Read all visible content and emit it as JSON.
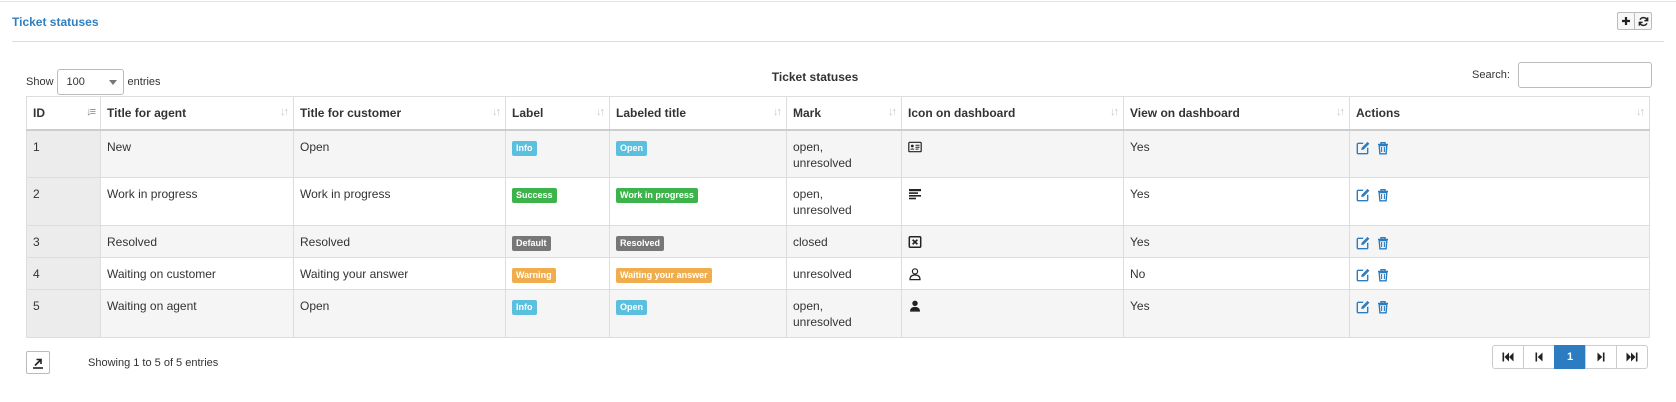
{
  "panel": {
    "title": "Ticket statuses"
  },
  "header_buttons": [
    {
      "icon": "plus-icon"
    },
    {
      "icon": "refresh-icon"
    }
  ],
  "length": {
    "show_label": "Show",
    "value": "100",
    "entries_label": "entries"
  },
  "table_caption": "Ticket statuses",
  "search": {
    "label": "Search:",
    "value": ""
  },
  "columns": [
    "ID",
    "Title for agent",
    "Title for customer",
    "Label",
    "Labeled title",
    "Mark",
    "Icon on dashboard",
    "View on dashboard",
    "Actions"
  ],
  "rows": [
    {
      "id": "1",
      "title_agent": "New",
      "title_customer": "Open",
      "label": "Info",
      "label_color": "#5bc0de",
      "labeled_title": "Open",
      "mark_line1": "open,",
      "mark_line2": "unresolved",
      "dashboard_icon": "id-card-icon",
      "view_on_dashboard": "Yes"
    },
    {
      "id": "2",
      "title_agent": "Work in progress",
      "title_customer": "Work in progress",
      "label": "Success",
      "label_color": "#3cb44b",
      "labeled_title": "Work in progress",
      "mark_line1": "open,",
      "mark_line2": "unresolved",
      "dashboard_icon": "tasks-icon",
      "view_on_dashboard": "Yes"
    },
    {
      "id": "3",
      "title_agent": "Resolved",
      "title_customer": "Resolved",
      "label": "Default",
      "label_color": "#777777",
      "labeled_title": "Resolved",
      "mark_line1": "closed",
      "mark_line2": "",
      "dashboard_icon": "close-box-icon",
      "view_on_dashboard": "Yes"
    },
    {
      "id": "4",
      "title_agent": "Waiting on customer",
      "title_customer": "Waiting your answer",
      "label": "Warning",
      "label_color": "#f0ad4e",
      "labeled_title": "Waiting your answer",
      "mark_line1": "unresolved",
      "mark_line2": "",
      "dashboard_icon": "user-outline-icon",
      "view_on_dashboard": "No"
    },
    {
      "id": "5",
      "title_agent": "Waiting on agent",
      "title_customer": "Open",
      "label": "Info",
      "label_color": "#5bc0de",
      "labeled_title": "Open",
      "mark_line1": "open,",
      "mark_line2": "unresolved",
      "dashboard_icon": "user-icon",
      "view_on_dashboard": "Yes"
    }
  ],
  "footer": {
    "info": "Showing 1 to 5 of 5 entries"
  },
  "pagination": {
    "current": "1"
  },
  "colors": {
    "accent": "#2b7cc1",
    "title": "#2f7fc1",
    "action_icon": "#2b7cc1"
  }
}
